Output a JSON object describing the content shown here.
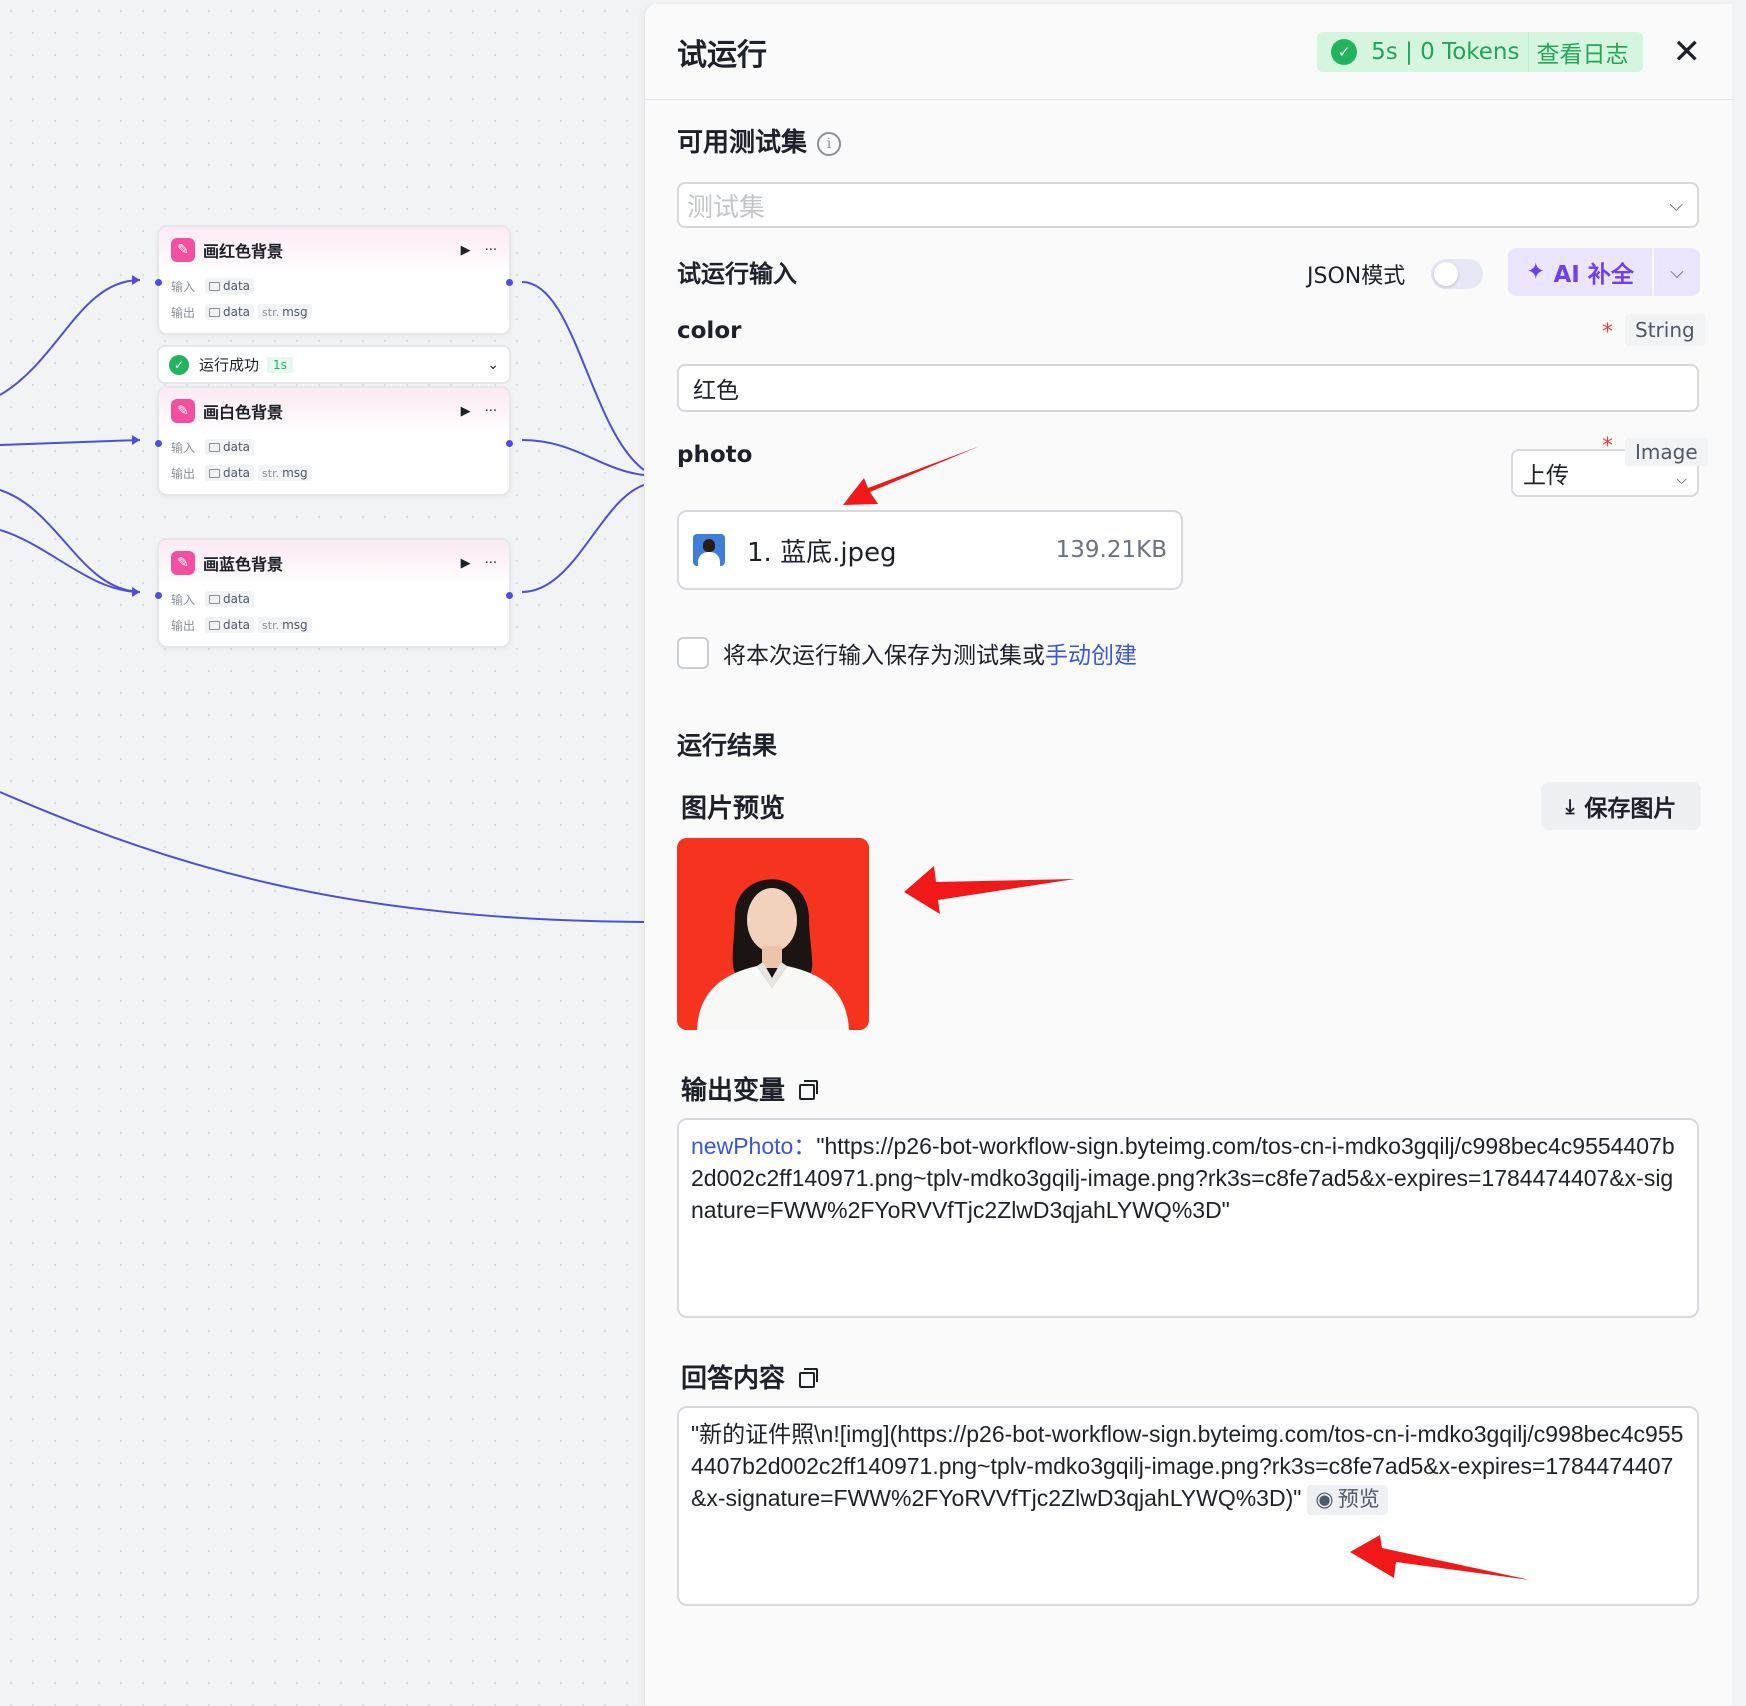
{
  "canvas": {
    "nodes": [
      {
        "title": "画红色背景",
        "input_label": "输入",
        "output_label": "输出",
        "input_var": "data",
        "output_var": "data",
        "output_type": "str.",
        "output_var2": "msg",
        "run": "▶",
        "more": "···"
      },
      {
        "title": "画白色背景",
        "input_label": "输入",
        "output_label": "输出",
        "input_var": "data",
        "output_var": "data",
        "output_type": "str.",
        "output_var2": "msg",
        "run": "▶",
        "more": "···"
      },
      {
        "title": "画蓝色背景",
        "input_label": "输入",
        "output_label": "输出",
        "input_var": "data",
        "output_var": "data",
        "output_type": "str.",
        "output_var2": "msg",
        "run": "▶",
        "more": "···"
      }
    ],
    "status": {
      "text": "运行成功",
      "time": "1s"
    }
  },
  "panel": {
    "title": "试运行",
    "badge": {
      "stats": "5s | 0 Tokens",
      "log_link": "查看日志"
    },
    "close_icon": "close-icon",
    "test_set": {
      "title": "可用测试集",
      "placeholder": "测试集"
    },
    "input_section": {
      "title": "试运行输入",
      "json_mode_label": "JSON模式",
      "ai_button": "AI 补全"
    },
    "fields": {
      "color": {
        "label": "color",
        "type": "String",
        "value": "红色"
      },
      "photo": {
        "label": "photo",
        "type": "Image",
        "upload_label": "上传",
        "file_name": "1. 蓝底.jpeg",
        "file_size": "139.21KB"
      }
    },
    "save_option": {
      "text": "将本次运行输入保存为测试集或",
      "link": "手动创建"
    },
    "result": {
      "title": "运行结果",
      "image_preview_title": "图片预览",
      "save_image_button": "保存图片",
      "output_vars_title": "输出变量",
      "output_key": "newPhoto：",
      "output_value": "\"https://p26-bot-workflow-sign.byteimg.com/tos-cn-i-mdko3gqilj/c998bec4c9554407b2d002c2ff140971.png~tplv-mdko3gqilj-image.png?rk3s=c8fe7ad5&x-expires=1784474407&x-signature=FWW%2FYoRVVfTjc2ZlwD3qjahLYWQ%3D\"",
      "answer_title": "回答内容",
      "answer_value": "\"新的证件照\\n![img](https://p26-bot-workflow-sign.byteimg.com/tos-cn-i-mdko3gqilj/c998bec4c9554407b2d002c2ff140971.png~tplv-mdko3gqilj-image.png?rk3s=c8fe7ad5&x-expires=1784474407&x-signature=FWW%2FYoRVVfTjc2ZlwD3qjahLYWQ%3D)\"",
      "preview_chip": "预览"
    }
  },
  "colors": {
    "accent": "#3a56e0",
    "success": "#22b35e",
    "ai_purple": "#6f3ff5",
    "edge": "#4c4fdb",
    "result_bg": "#f5331e",
    "arrow": "#f01818"
  }
}
